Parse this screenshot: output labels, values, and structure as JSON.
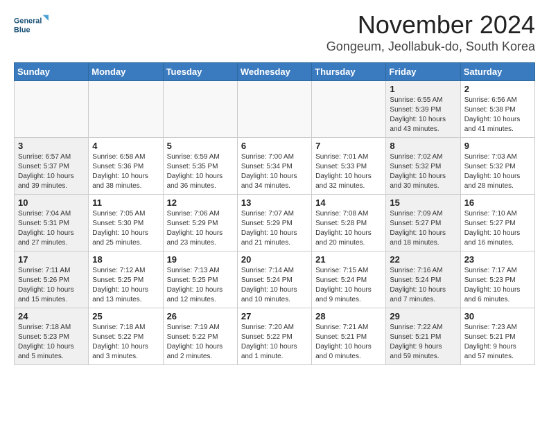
{
  "header": {
    "logo_line1": "General",
    "logo_line2": "Blue",
    "title": "November 2024",
    "subtitle": "Gongeum, Jeollabuk-do, South Korea"
  },
  "weekdays": [
    "Sunday",
    "Monday",
    "Tuesday",
    "Wednesday",
    "Thursday",
    "Friday",
    "Saturday"
  ],
  "weeks": [
    [
      {
        "day": "",
        "info": "",
        "empty": true
      },
      {
        "day": "",
        "info": "",
        "empty": true
      },
      {
        "day": "",
        "info": "",
        "empty": true
      },
      {
        "day": "",
        "info": "",
        "empty": true
      },
      {
        "day": "",
        "info": "",
        "empty": true
      },
      {
        "day": "1",
        "info": "Sunrise: 6:55 AM\nSunset: 5:39 PM\nDaylight: 10 hours\nand 43 minutes.",
        "empty": false,
        "shaded": true
      },
      {
        "day": "2",
        "info": "Sunrise: 6:56 AM\nSunset: 5:38 PM\nDaylight: 10 hours\nand 41 minutes.",
        "empty": false
      }
    ],
    [
      {
        "day": "3",
        "info": "Sunrise: 6:57 AM\nSunset: 5:37 PM\nDaylight: 10 hours\nand 39 minutes.",
        "empty": false,
        "shaded": true
      },
      {
        "day": "4",
        "info": "Sunrise: 6:58 AM\nSunset: 5:36 PM\nDaylight: 10 hours\nand 38 minutes.",
        "empty": false
      },
      {
        "day": "5",
        "info": "Sunrise: 6:59 AM\nSunset: 5:35 PM\nDaylight: 10 hours\nand 36 minutes.",
        "empty": false
      },
      {
        "day": "6",
        "info": "Sunrise: 7:00 AM\nSunset: 5:34 PM\nDaylight: 10 hours\nand 34 minutes.",
        "empty": false
      },
      {
        "day": "7",
        "info": "Sunrise: 7:01 AM\nSunset: 5:33 PM\nDaylight: 10 hours\nand 32 minutes.",
        "empty": false
      },
      {
        "day": "8",
        "info": "Sunrise: 7:02 AM\nSunset: 5:32 PM\nDaylight: 10 hours\nand 30 minutes.",
        "empty": false,
        "shaded": true
      },
      {
        "day": "9",
        "info": "Sunrise: 7:03 AM\nSunset: 5:32 PM\nDaylight: 10 hours\nand 28 minutes.",
        "empty": false
      }
    ],
    [
      {
        "day": "10",
        "info": "Sunrise: 7:04 AM\nSunset: 5:31 PM\nDaylight: 10 hours\nand 27 minutes.",
        "empty": false,
        "shaded": true
      },
      {
        "day": "11",
        "info": "Sunrise: 7:05 AM\nSunset: 5:30 PM\nDaylight: 10 hours\nand 25 minutes.",
        "empty": false
      },
      {
        "day": "12",
        "info": "Sunrise: 7:06 AM\nSunset: 5:29 PM\nDaylight: 10 hours\nand 23 minutes.",
        "empty": false
      },
      {
        "day": "13",
        "info": "Sunrise: 7:07 AM\nSunset: 5:29 PM\nDaylight: 10 hours\nand 21 minutes.",
        "empty": false
      },
      {
        "day": "14",
        "info": "Sunrise: 7:08 AM\nSunset: 5:28 PM\nDaylight: 10 hours\nand 20 minutes.",
        "empty": false
      },
      {
        "day": "15",
        "info": "Sunrise: 7:09 AM\nSunset: 5:27 PM\nDaylight: 10 hours\nand 18 minutes.",
        "empty": false,
        "shaded": true
      },
      {
        "day": "16",
        "info": "Sunrise: 7:10 AM\nSunset: 5:27 PM\nDaylight: 10 hours\nand 16 minutes.",
        "empty": false
      }
    ],
    [
      {
        "day": "17",
        "info": "Sunrise: 7:11 AM\nSunset: 5:26 PM\nDaylight: 10 hours\nand 15 minutes.",
        "empty": false,
        "shaded": true
      },
      {
        "day": "18",
        "info": "Sunrise: 7:12 AM\nSunset: 5:25 PM\nDaylight: 10 hours\nand 13 minutes.",
        "empty": false
      },
      {
        "day": "19",
        "info": "Sunrise: 7:13 AM\nSunset: 5:25 PM\nDaylight: 10 hours\nand 12 minutes.",
        "empty": false
      },
      {
        "day": "20",
        "info": "Sunrise: 7:14 AM\nSunset: 5:24 PM\nDaylight: 10 hours\nand 10 minutes.",
        "empty": false
      },
      {
        "day": "21",
        "info": "Sunrise: 7:15 AM\nSunset: 5:24 PM\nDaylight: 10 hours\nand 9 minutes.",
        "empty": false
      },
      {
        "day": "22",
        "info": "Sunrise: 7:16 AM\nSunset: 5:24 PM\nDaylight: 10 hours\nand 7 minutes.",
        "empty": false,
        "shaded": true
      },
      {
        "day": "23",
        "info": "Sunrise: 7:17 AM\nSunset: 5:23 PM\nDaylight: 10 hours\nand 6 minutes.",
        "empty": false
      }
    ],
    [
      {
        "day": "24",
        "info": "Sunrise: 7:18 AM\nSunset: 5:23 PM\nDaylight: 10 hours\nand 5 minutes.",
        "empty": false,
        "shaded": true
      },
      {
        "day": "25",
        "info": "Sunrise: 7:18 AM\nSunset: 5:22 PM\nDaylight: 10 hours\nand 3 minutes.",
        "empty": false
      },
      {
        "day": "26",
        "info": "Sunrise: 7:19 AM\nSunset: 5:22 PM\nDaylight: 10 hours\nand 2 minutes.",
        "empty": false
      },
      {
        "day": "27",
        "info": "Sunrise: 7:20 AM\nSunset: 5:22 PM\nDaylight: 10 hours\nand 1 minute.",
        "empty": false
      },
      {
        "day": "28",
        "info": "Sunrise: 7:21 AM\nSunset: 5:21 PM\nDaylight: 10 hours\nand 0 minutes.",
        "empty": false
      },
      {
        "day": "29",
        "info": "Sunrise: 7:22 AM\nSunset: 5:21 PM\nDaylight: 9 hours\nand 59 minutes.",
        "empty": false,
        "shaded": true
      },
      {
        "day": "30",
        "info": "Sunrise: 7:23 AM\nSunset: 5:21 PM\nDaylight: 9 hours\nand 57 minutes.",
        "empty": false
      }
    ]
  ]
}
